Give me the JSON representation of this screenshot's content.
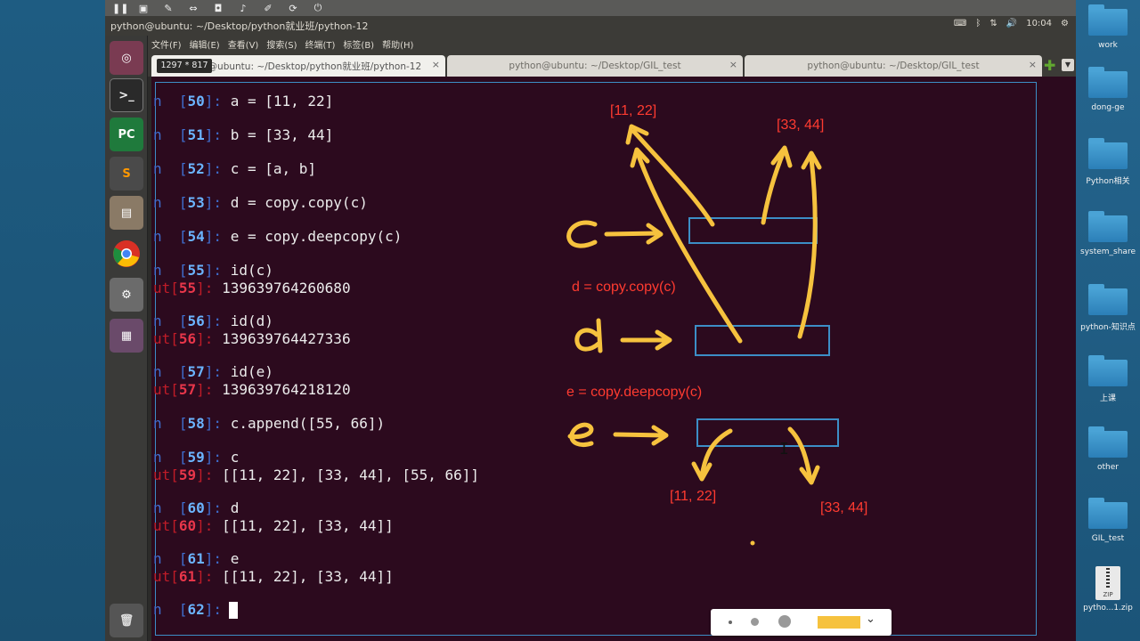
{
  "window": {
    "title": "python@ubuntu: ~/Desktop/python就业班/python-12",
    "clock": "10:04",
    "size_badge": "1297 * 817"
  },
  "menu": [
    "文件(F)",
    "编辑(E)",
    "查看(V)",
    "搜索(S)",
    "终端(T)",
    "标签(B)",
    "帮助(H)"
  ],
  "tabs": [
    {
      "label": "python@ubuntu: ~/Desktop/python就业班/python-12",
      "active": true
    },
    {
      "label": "python@ubuntu: ~/Desktop/GIL_test",
      "active": false
    },
    {
      "label": "python@ubuntu: ~/Desktop/GIL_test",
      "active": false
    }
  ],
  "launcher": [
    {
      "icon": "ubuntu-dash-icon"
    },
    {
      "icon": "terminal-icon"
    },
    {
      "icon": "pycharm-icon"
    },
    {
      "icon": "sublime-text-icon"
    },
    {
      "icon": "files-icon"
    },
    {
      "icon": "chrome-icon"
    },
    {
      "icon": "settings-icon"
    },
    {
      "icon": "workspace-icon"
    },
    {
      "icon": "trash-icon"
    }
  ],
  "terminal_lines": [
    {
      "kind": "in",
      "n": "50",
      "code": "a = [11, 22]"
    },
    {
      "kind": "in",
      "n": "51",
      "code": "b = [33, 44]"
    },
    {
      "kind": "in",
      "n": "52",
      "code": "c = [a, b]"
    },
    {
      "kind": "in",
      "n": "53",
      "code": "d = copy.copy(c)"
    },
    {
      "kind": "in",
      "n": "54",
      "code": "e = copy.deepcopy(c)"
    },
    {
      "kind": "in",
      "n": "55",
      "code": "id(c)"
    },
    {
      "kind": "out",
      "n": "55",
      "code": "139639764260680"
    },
    {
      "kind": "in",
      "n": "56",
      "code": "id(d)"
    },
    {
      "kind": "out",
      "n": "56",
      "code": "139639764427336"
    },
    {
      "kind": "in",
      "n": "57",
      "code": "id(e)"
    },
    {
      "kind": "out",
      "n": "57",
      "code": "139639764218120"
    },
    {
      "kind": "in",
      "n": "58",
      "code": "c.append([55, 66])"
    },
    {
      "kind": "in",
      "n": "59",
      "code": "c"
    },
    {
      "kind": "out",
      "n": "59",
      "code": "[[11, 22], [33, 44], [55, 66]]"
    },
    {
      "kind": "in",
      "n": "60",
      "code": "d"
    },
    {
      "kind": "out",
      "n": "60",
      "code": "[[11, 22], [33, 44]]"
    },
    {
      "kind": "in",
      "n": "61",
      "code": "e"
    },
    {
      "kind": "out",
      "n": "61",
      "code": "[[11, 22], [33, 44]]"
    },
    {
      "kind": "in",
      "n": "62",
      "code": ""
    }
  ],
  "annotations": {
    "top_left_list": "[11, 22]",
    "top_right_list": "[33, 44]",
    "d_caption": "d = copy.copy(c)",
    "e_caption": "e = copy.deepcopy(c)",
    "bottom_left_list": "[11, 22]",
    "bottom_right_list": "[33, 44]",
    "c_letter": "c",
    "d_letter": "d",
    "e_letter": "e",
    "label_color": "#ff3b30",
    "arrow_color": "#f6c23e",
    "box_color": "#3c8ec6"
  },
  "draw_toolbar": {
    "selected_color": "#f6c23e"
  },
  "desktop_icons": [
    "work",
    "dong-ge",
    "Python相关",
    "system_share",
    "python-知识点",
    "上课",
    "other",
    "GIL_test",
    "pytho...1.zip"
  ]
}
